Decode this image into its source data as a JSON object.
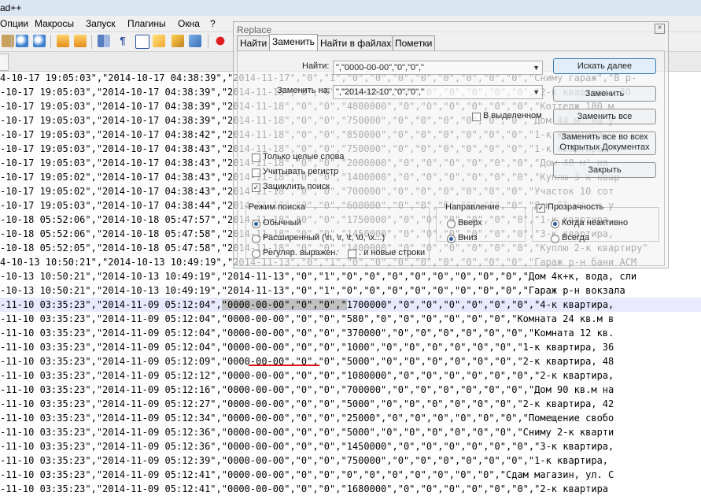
{
  "window": {
    "title": "ad++"
  },
  "menu": [
    "Опции",
    "Макросы",
    "Запуск",
    "Плагины",
    "Окна",
    "?"
  ],
  "toolbar_icons": [
    "zoom-in-icon",
    "zoom-out-icon",
    "sync-v-icon",
    "sync-h-icon",
    "wrap-icon",
    "all-chars-icon",
    "indent-guide-icon",
    "lang-icon",
    "doc-map-icon",
    "func-list-icon",
    "record-macro-icon"
  ],
  "editor": {
    "lines": [
      "4-10-17 19:05:03\",\"2014-10-17 04:38:39\",\"2014-11-17\",\"0\",\"1\",\"0\",\"0\",\"0\",\"0\",\"0\",\"0\",\"0\",\"0\",\"Сниму гараж\",\"В р-",
      "-10-17 19:05:03\",\"2014-10-17 04:38:39\",\"2014-11-18\",\"0\",\"0\",\"4500000\",\"0\",\"0\",\"0\",\"0\",\"0\",\"0\",\"2-к квартира, 30",
      "-10-17 19:05:03\",\"2014-10-17 04:38:39\",\"2014-11-18\",\"0\",\"0\",\"4800000\",\"0\",\"0\",\"0\",\"0\",\"0\",\"0\",\"Коттедж 180 м",
      "-10-17 19:05:03\",\"2014-10-17 04:38:39\",\"2014-11-18\",\"0\",\"0\",\"750000\",\"0\",\"0\",\"0\",\"0\",\"0\",\"0\",\"Дом 44 м² на у",
      "-10-17 19:05:03\",\"2014-10-17 04:38:42\",\"2014-11-18\",\"0\",\"0\",\"850000\",\"0\",\"0\",\"0\",\"0\",\"0\",\"0\",\"1-к квартира,",
      "-10-17 19:05:03\",\"2014-10-17 04:38:43\",\"2014-11-18\",\"0\",\"0\",\"750000\",\"0\",\"0\",\"0\",\"0\",\"0\",\"0\",\"1-к квартира,",
      "-10-17 19:05:03\",\"2014-10-17 04:38:43\",\"2014-11-18\",\"0\",\"0\",\"2000000\",\"0\",\"0\",\"0\",\"0\",\"0\",\"0\",\"Дом 48 м² на",
      "-10-17 19:05:02\",\"2014-10-17 04:38:43\",\"2014-11-18\",\"0\",\"0\",\"1400000\",\"0\",\"0\",\"0\",\"0\",\"0\",\"0\",\"Куплю 3-к квар",
      "-10-17 19:05:02\",\"2014-10-17 04:38:43\",\"2014-11-18\",\"0\",\"0\",\"700000\",\"0\",\"0\",\"0\",\"0\",\"0\",\"0\",\"Участок 10 сот",
      "-10-17 19:05:03\",\"2014-10-17 04:38:44\",\"2014-11-18\",\"0\",\"0\",\"600000\",\"0\",\"0\",\"0\",\"0\",\"0\",\"0\",\"Дом 61 м² на у",
      "-10-18 05:52:06\",\"2014-10-18 05:47:57\",\"2014-11-18\",\"0\",\"0\",\"1750000\",\"0\",\"0\",\"0\",\"0\",\"0\",\"0\",\"1-к квартира,",
      "-10-18 05:52:06\",\"2014-10-18 05:47:58\",\"2014-11-18\",\"0\",\"0\",\"1450000\",\"0\",\"0\",\"0\",\"0\",\"0\",\"0\",\"3-к квартира,",
      "-10-18 05:52:05\",\"2014-10-18 05:47:58\",\"2014-11-18\",\"0\",\"0\",\"1400000\",\"0\",\"0\",\"0\",\"0\",\"0\",\"0\",\"Куплю 2-к квартиру\"",
      "4-10-13 10:50:21\",\"2014-10-13 10:49:19\",\"2014-11-13\",\"0\",\"1\",\"0\",\"0\",\"0\",\"0\",\"0\",\"0\",\"0\",\"0\",\"Гараж р-н бани АСМ",
      "-10-13 10:50:21\",\"2014-10-13 10:49:19\",\"2014-11-13\",\"0\",\"1\",\"0\",\"0\",\"0\",\"0\",\"0\",\"0\",\"0\",\"0\",\"Дом 4к+к, вода, сли",
      "-10-13 10:50:21\",\"2014-10-13 10:49:19\",\"2014-11-13\",\"0\",\"1\",\"0\",\"0\",\"0\",\"0\",\"0\",\"0\",\"0\",\"0\",\"Гараж р-н вокзала",
      "-11-10 03:35:23\",\"2014-11-09 05:12:04\",\"0000-00-00\",\"0\",\"0\",\"1700000\",\"0\",\"0\",\"0\",\"0\",\"0\",\"0\",\"4-к квартира,",
      "-11-10 03:35:23\",\"2014-11-09 05:12:04\",\"0000-00-00\",\"0\",\"0\",\"580\",\"0\",\"0\",\"0\",\"0\",\"0\",\"0\",\"Комната 24 кв.м в",
      "-11-10 03:35:23\",\"2014-11-09 05:12:04\",\"0000-00-00\",\"0\",\"0\",\"370000\",\"0\",\"0\",\"0\",\"0\",\"0\",\"0\",\"Комната 12 кв.",
      "-11-10 03:35:23\",\"2014-11-09 05:12:04\",\"0000-00-00\",\"0\",\"0\",\"1000\",\"0\",\"0\",\"0\",\"0\",\"0\",\"0\",\"1-к квартира, 36",
      "-11-10 03:35:23\",\"2014-11-09 05:12:09\",\"0000-00-00\",\"0\",\"0\",\"5000\",\"0\",\"0\",\"0\",\"0\",\"0\",\"0\",\"2-к квартира, 48",
      "-11-10 03:35:23\",\"2014-11-09 05:12:12\",\"0000-00-00\",\"0\",\"0\",\"1080000\",\"0\",\"0\",\"0\",\"0\",\"0\",\"0\",\"2-к квартира,",
      "-11-10 03:35:23\",\"2014-11-09 05:12:16\",\"0000-00-00\",\"0\",\"0\",\"700000\",\"0\",\"0\",\"0\",\"0\",\"0\",\"0\",\"Дом 90 кв.м на",
      "-11-10 03:35:23\",\"2014-11-09 05:12:27\",\"0000-00-00\",\"0\",\"0\",\"5000\",\"0\",\"0\",\"0\",\"0\",\"0\",\"0\",\"2-к квартира, 42",
      "-11-10 03:35:23\",\"2014-11-09 05:12:34\",\"0000-00-00\",\"0\",\"0\",\"25000\",\"0\",\"0\",\"0\",\"0\",\"0\",\"0\",\"Помещение свобо",
      "-11-10 03:35:23\",\"2014-11-09 05:12:36\",\"0000-00-00\",\"0\",\"0\",\"5000\",\"0\",\"0\",\"0\",\"0\",\"0\",\"0\",\"Сниму 2-к кварти",
      "-11-10 03:35:23\",\"2014-11-09 05:12:36\",\"0000-00-00\",\"0\",\"0\",\"1450000\",\"0\",\"0\",\"0\",\"0\",\"0\",\"0\",\"3-к квартира,",
      "-11-10 03:35:23\",\"2014-11-09 05:12:39\",\"0000-00-00\",\"0\",\"0\",\"750000\",\"0\",\"0\",\"0\",\"0\",\"0\",\"0\",\"1-к квартира,",
      "-11-10 03:35:23\",\"2014-11-09 05:12:41\",\"0000-00-00\",\"0\",\"0\",\"0\",\"0\",\"0\",\"0\",\"0\",\"0\",\"0\",\"Сдам магазин, ул. С",
      "-11-10 03:35:23\",\"2014-11-09 05:12:41\",\"0000-00-00\",\"0\",\"0\",\"1680000\",\"0\",\"0\",\"0\",\"0\",\"0\",\"0\",\"2-к квартира"
    ],
    "current_line_index": 16,
    "selection_text": "\"0000-00-00\",\"0\",\"0\",\""
  },
  "dialog": {
    "title": "Replace",
    "tabs": [
      "Найти",
      "Заменить",
      "Найти в файлах",
      "Пометки"
    ],
    "active_tab": "Заменить",
    "find_label": "Найти:",
    "find_value": "\",\"0000-00-00\",\"0\",\"0\",\"",
    "replace_label": "Заменить на:",
    "replace_value": "\",\"2014-12-10\",\"0\",\"0\",\"",
    "in_selection_label": "В выделенном",
    "buttons": {
      "find_next": "Искать далее",
      "replace": "Заменить",
      "replace_all": "Заменить все",
      "replace_all_open": "Заменить все во всех Открытых Документах",
      "close": "Закрыть"
    },
    "options": {
      "whole_word": "Только целые слова",
      "match_case": "Учитывать регистр",
      "wrap_around": "Зациклить поиск"
    },
    "search_mode": {
      "title": "Режим поиска",
      "normal": "Обычный",
      "extended": "Расширенный (\\n, \\r, \\t, \\0, \\x...)",
      "regex": "Регуляр. выражен.",
      "newline": ". и новые строки",
      "selected": "normal"
    },
    "direction": {
      "title": "Направление",
      "up": "Вверх",
      "down": "Вниз",
      "selected": "down"
    },
    "transparency": {
      "title": "Прозрачность",
      "on_lose_focus": "Когда неактивно",
      "always": "Всегда",
      "selected": "on_lose_focus"
    }
  },
  "colors": {
    "selection": "#c0c0c0",
    "current_line": "#e8e8ff",
    "underline": "#dd1111"
  }
}
